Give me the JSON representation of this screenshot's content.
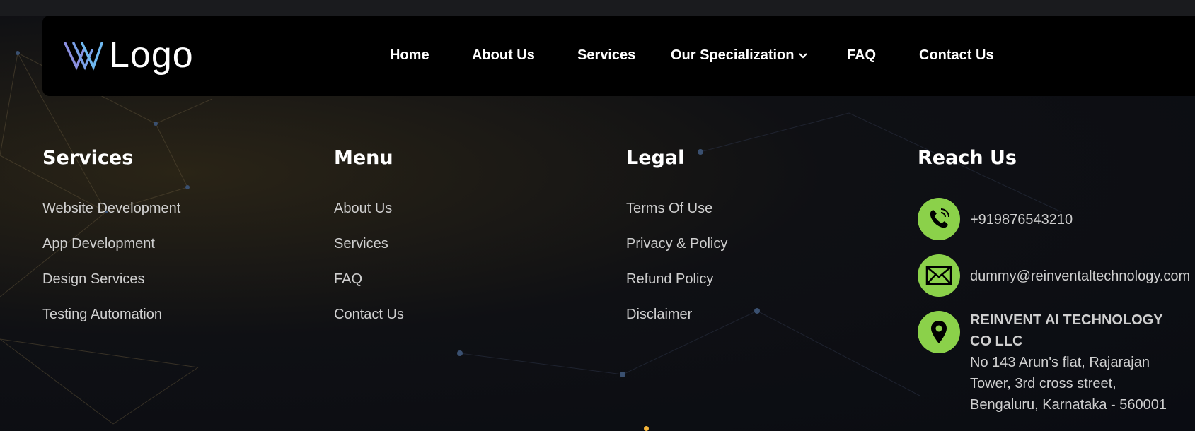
{
  "header": {
    "logo_text": "Logo",
    "nav": [
      "Home",
      "About Us",
      "Services",
      "Our Specialization",
      "FAQ",
      "Contact Us"
    ]
  },
  "footer": {
    "services": {
      "title": "Services",
      "items": [
        "Website Development",
        "App Development",
        "Design Services",
        "Testing Automation"
      ]
    },
    "menu": {
      "title": "Menu",
      "items": [
        "About Us",
        "Services",
        "FAQ",
        "Contact Us"
      ]
    },
    "legal": {
      "title": "Legal",
      "items": [
        "Terms Of Use",
        "Privacy & Policy",
        "Refund Policy",
        "Disclaimer"
      ]
    },
    "reach": {
      "title": "Reach Us",
      "phone": "+919876543210",
      "email": "dummy@reinventaltechnology.com",
      "company": "REINVENT AI TECHNOLOGY CO LLC",
      "address": "No 143 Arun's flat, Rajarajan Tower, 3rd cross street, Bengaluru, Karnataka - 560001"
    }
  },
  "colors": {
    "accent": "#8bd14a",
    "nav_bg": "#000000",
    "link": "#cfcfcf"
  },
  "icons": [
    "phone-icon",
    "mail-icon",
    "location-pin-icon",
    "chevron-down-icon"
  ]
}
